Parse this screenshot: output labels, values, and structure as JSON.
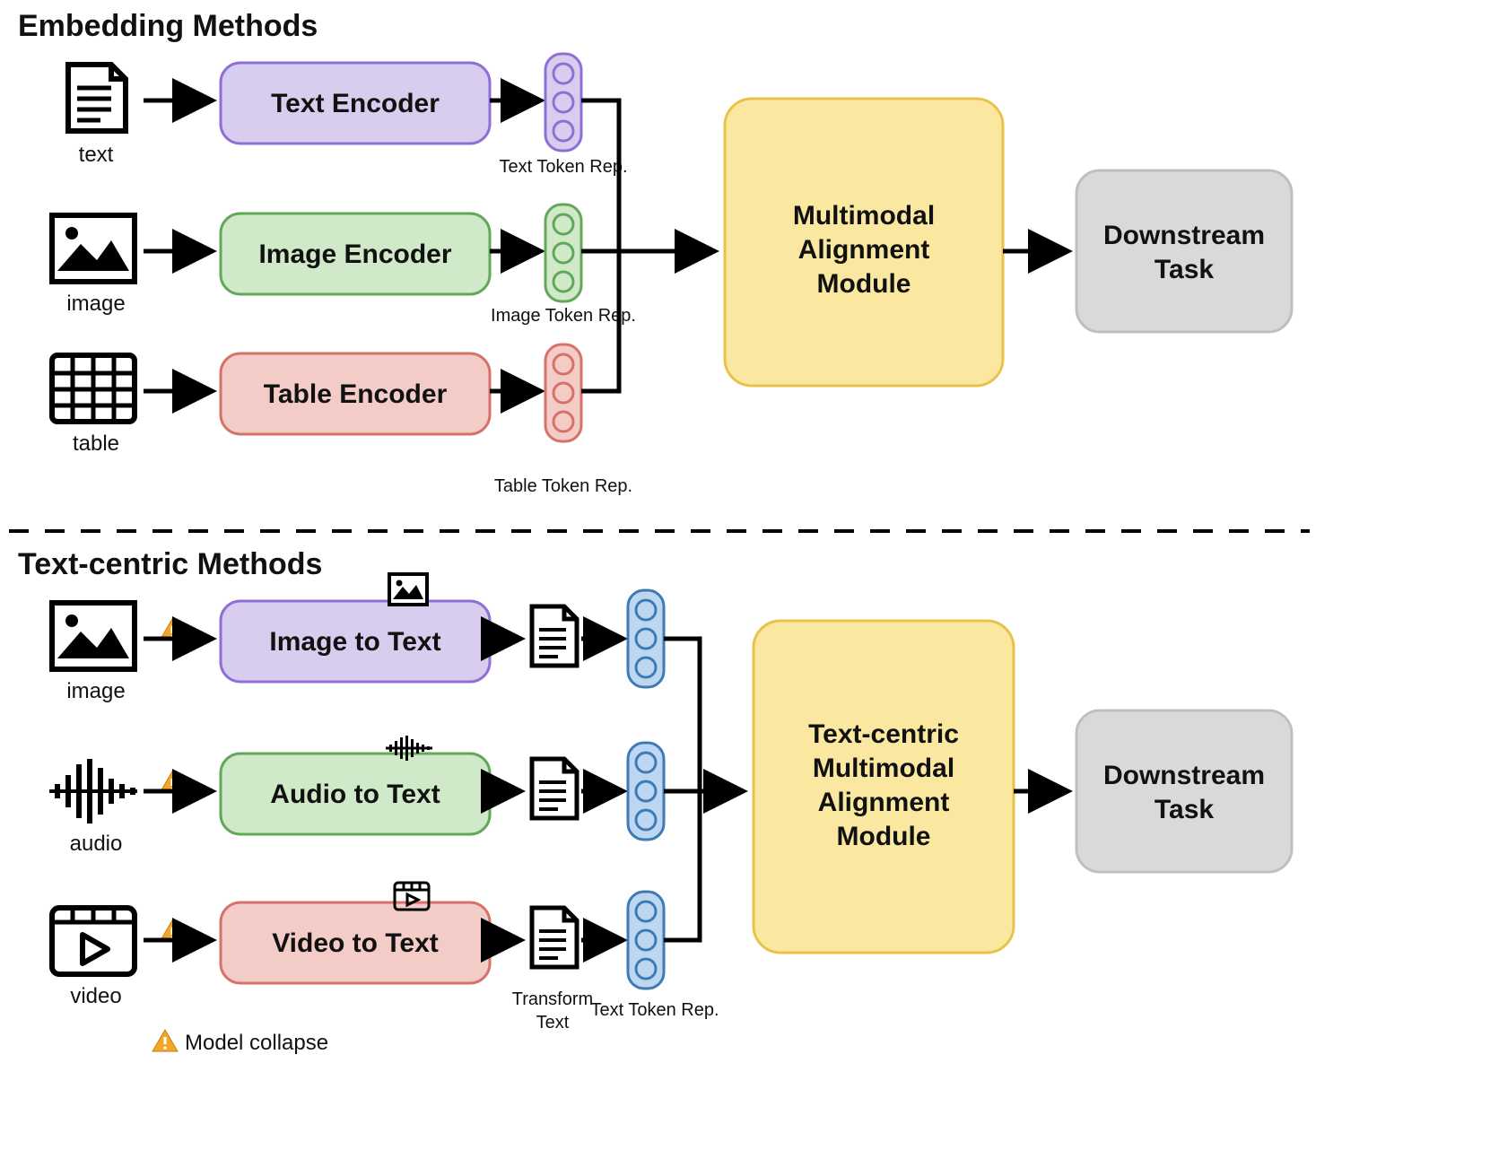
{
  "section1": {
    "title": "Embedding Methods",
    "inputs": [
      "text",
      "image",
      "table"
    ],
    "encoders": [
      "Text Encoder",
      "Image Encoder",
      "Table Encoder"
    ],
    "tokenReps": [
      "Text Token Rep.",
      "Image Token Rep.",
      "Table Token Rep."
    ],
    "alignmentModule": [
      "Multimodal",
      "Alignment",
      "Module"
    ],
    "downstream": [
      "Downstream",
      "Task"
    ]
  },
  "section2": {
    "title": "Text-centric Methods",
    "inputs": [
      "image",
      "audio",
      "video"
    ],
    "converters": [
      "Image to Text",
      "Audio to Text",
      "Video to Text"
    ],
    "transformLabel": [
      "Transform",
      "Text"
    ],
    "tokenRepLabel": "Text Token Rep.",
    "alignmentModule": [
      "Text-centric",
      "Multimodal",
      "Alignment",
      "Module"
    ],
    "downstream": [
      "Downstream",
      "Task"
    ],
    "legend": "Model collapse"
  },
  "colors": {
    "purpleFill": "#d8cdee",
    "purpleStroke": "#8f6fd6",
    "greenFill": "#cfe9c9",
    "greenStroke": "#63a75a",
    "redFill": "#f3cbc7",
    "redStroke": "#d5726a",
    "yellowFill": "#fbe8a0",
    "yellowStroke": "#e8c24a",
    "greyFill": "#d9d9d9",
    "greyStroke": "#bfbfbf",
    "blueFill": "#bcd7ef",
    "blueStroke": "#3d7bb8",
    "arrow": "#000000"
  }
}
